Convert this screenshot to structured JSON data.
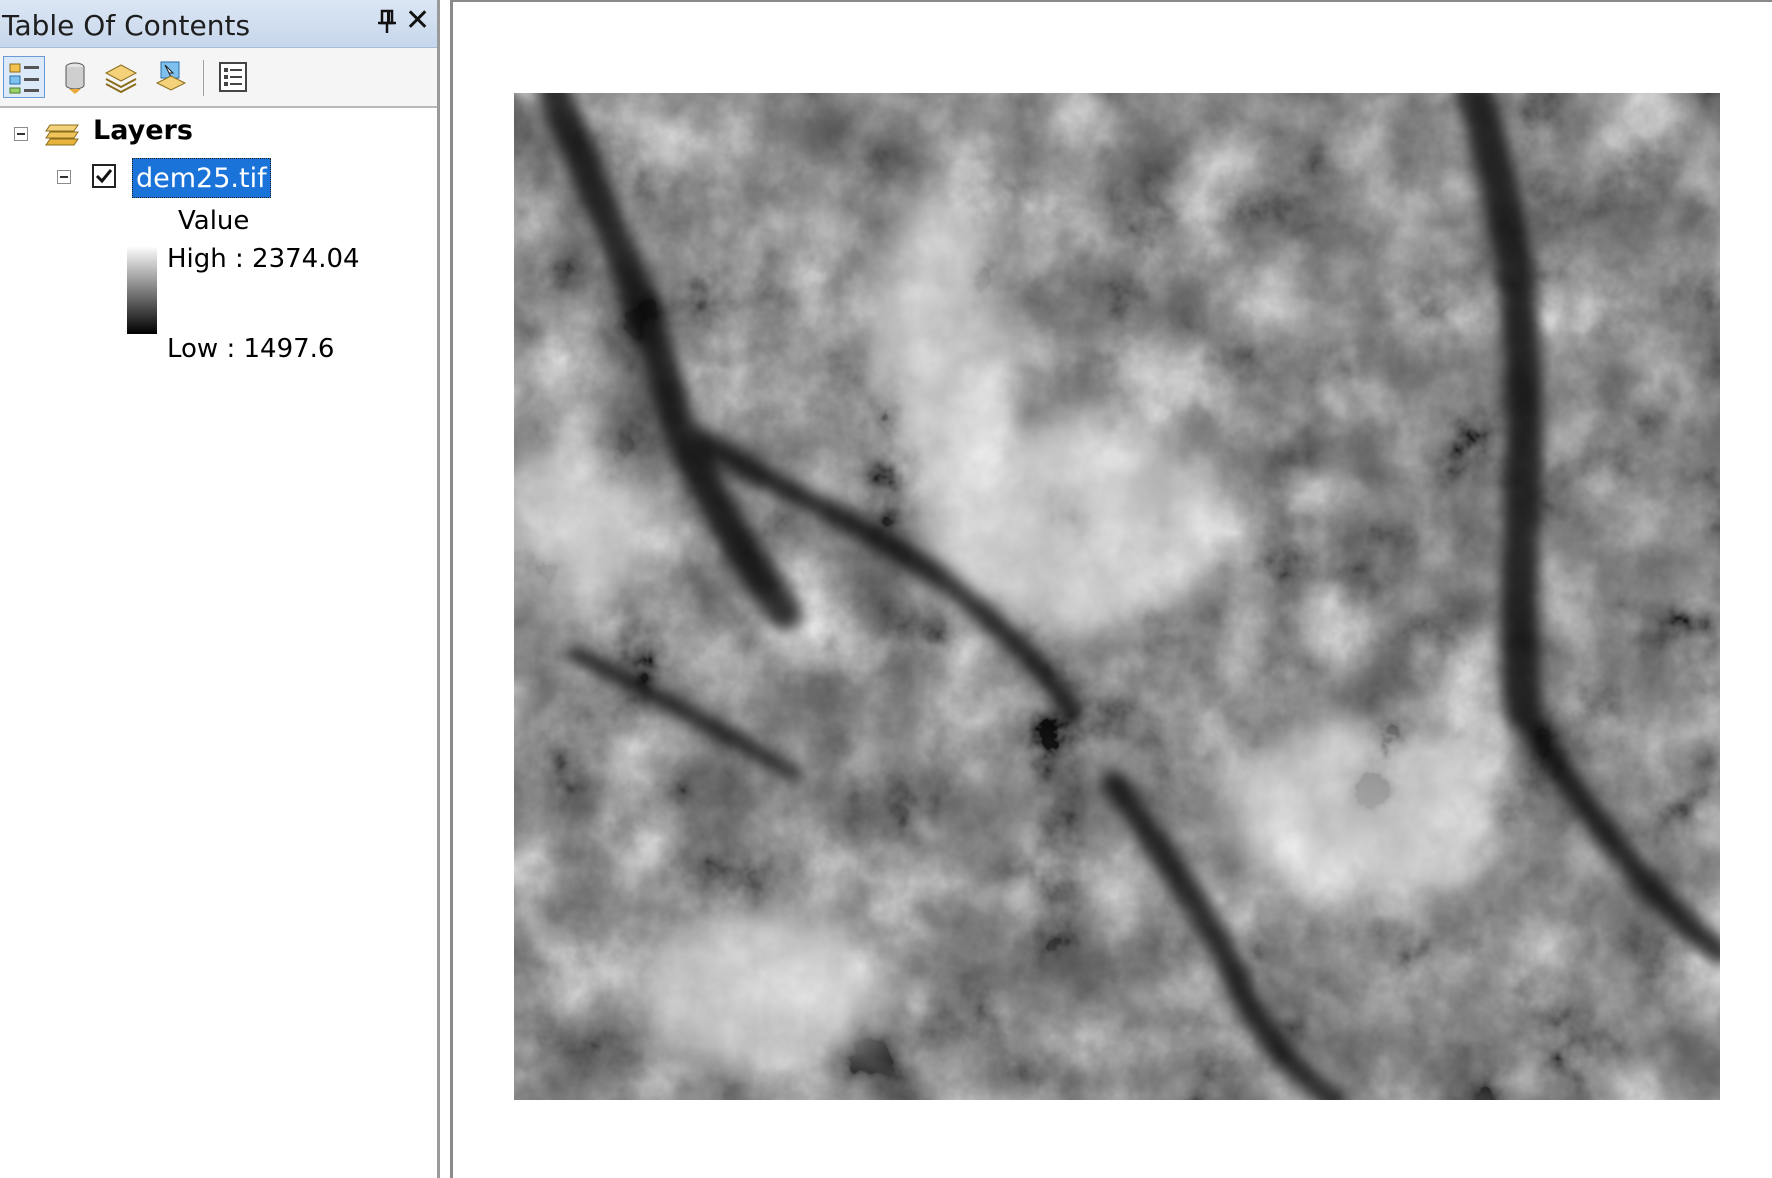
{
  "toc": {
    "title": "Table Of Contents",
    "toolbar": [
      {
        "name": "list-by-drawing-order",
        "icon": "drawing-order-icon",
        "active": true
      },
      {
        "name": "list-by-source",
        "icon": "database-icon",
        "active": false
      },
      {
        "name": "list-by-visibility",
        "icon": "layers-visibility-icon",
        "active": false
      },
      {
        "name": "list-by-selection",
        "icon": "selection-icon",
        "active": false
      },
      {
        "name": "options",
        "icon": "options-icon",
        "active": false
      }
    ],
    "tree": {
      "root_label": "Layers",
      "layer": {
        "name": "dem25.tif",
        "checked": true,
        "legend": {
          "field": "Value",
          "high": "High : 2374.04",
          "low": "Low : 1497.6",
          "ramp_colors": [
            "#ffffff",
            "#000000"
          ]
        }
      }
    }
  },
  "map": {
    "layer_shown": "dem25.tif",
    "render": "grayscale-stretched"
  },
  "colors": {
    "selection": "#1a73d9",
    "title_bar": "#c7d7ec"
  }
}
